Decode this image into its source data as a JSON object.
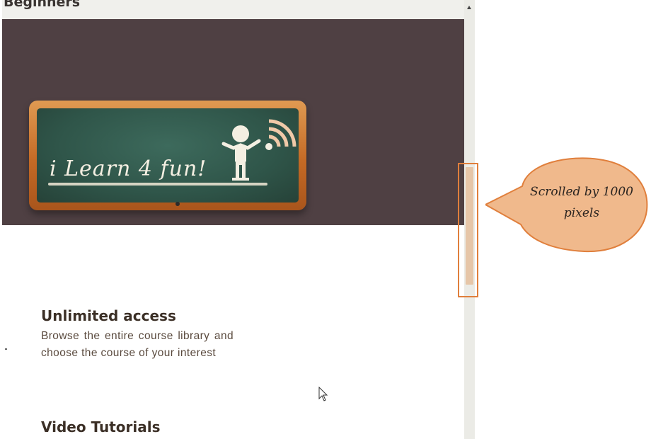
{
  "page": {
    "top_heading": "Beginners"
  },
  "hero": {
    "logo_text": "i Learn 4 fun!"
  },
  "features": [
    {
      "title": "Unlimited access",
      "description": "Browse the entire course library and choose the course of your interest"
    },
    {
      "title": "Video Tutorials",
      "description": ""
    }
  ],
  "annotation": {
    "callout_text": "Scrolled by 1000 pixels",
    "highlight_color": "#e07f3c",
    "bubble_color": "#f0b98c"
  },
  "colors": {
    "banner_background": "#4f4043",
    "chalkboard_green": "#2f5549",
    "frame_orange": "#c46a25",
    "scroll_thumb": "#e6c6a8"
  },
  "icons": {
    "stick_figure": "stick-figure-icon",
    "wifi": "wifi-icon",
    "cursor": "mouse-cursor-icon",
    "scroll_up": "scroll-up-arrow-icon"
  }
}
